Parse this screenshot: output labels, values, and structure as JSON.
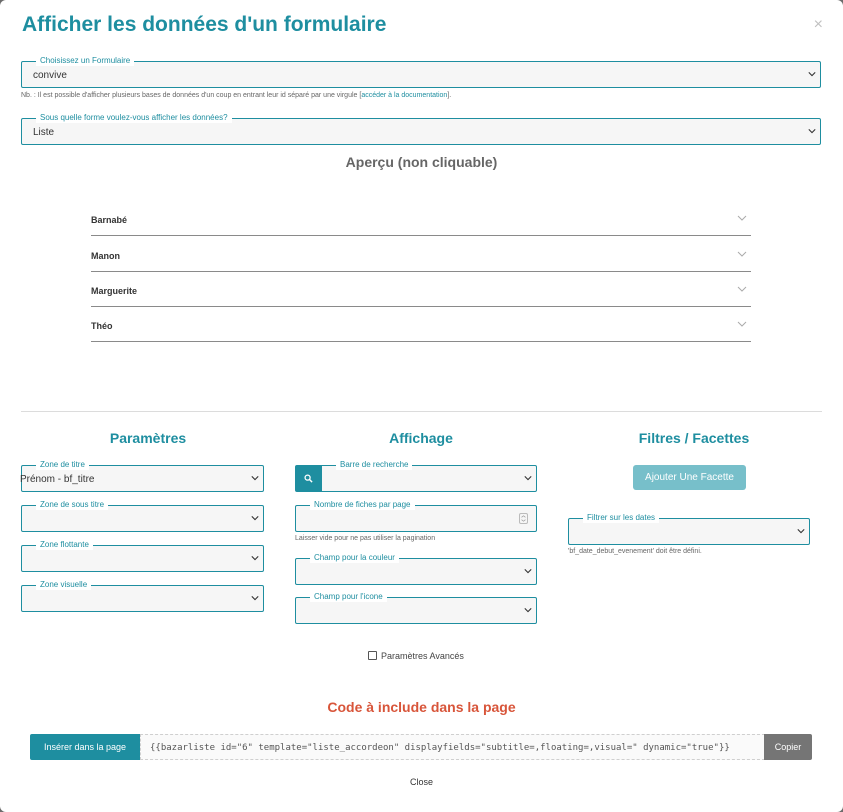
{
  "modal": {
    "title": "Afficher les données d'un formulaire",
    "close_symbol": "×"
  },
  "form_select": {
    "legend": "Choisissez un Formulaire",
    "value": "convive",
    "hint": "Nb. : Il est possible d'afficher plusieurs bases de données d'un coup en entrant leur id séparé par une virgule [",
    "hint_link": "accéder à la documentation",
    "hint_end": "]."
  },
  "display_select": {
    "legend": "Sous quelle forme voulez-vous afficher les données?",
    "value": "Liste"
  },
  "preview": {
    "title": "Aperçu (non cliquable)",
    "items": [
      {
        "label": "Barnabé"
      },
      {
        "label": "Manon"
      },
      {
        "label": "Marguerite"
      },
      {
        "label": "Théo"
      }
    ]
  },
  "parametres": {
    "title": "Paramètres",
    "zone_titre": {
      "legend": "Zone de titre",
      "value": "Prénom - bf_titre"
    },
    "zone_sous_titre": {
      "legend": "Zone de sous titre",
      "value": ""
    },
    "zone_flottante": {
      "legend": "Zone flottante",
      "value": ""
    },
    "zone_visuelle": {
      "legend": "Zone visuelle",
      "value": ""
    }
  },
  "affichage": {
    "title": "Affichage",
    "barre_recherche": {
      "legend": "Barre de recherche",
      "value": ""
    },
    "nombre_fiches": {
      "legend": "Nombre de fiches par page",
      "value": "",
      "hint": "Laisser vide pour ne pas utiliser la pagination"
    },
    "champ_couleur": {
      "legend": "Champ pour la couleur",
      "value": ""
    },
    "champ_icone": {
      "legend": "Champ pour l'icone",
      "value": ""
    }
  },
  "filtres": {
    "title": "Filtres / Facettes",
    "add_facet_label": "Ajouter Une Facette",
    "filtrer_dates": {
      "legend": "Filtrer sur les dates",
      "value": "",
      "hint": "'bf_date_debut_evenement' doit être défini."
    }
  },
  "advanced": {
    "label": "Paramètres Avancés",
    "checked": false
  },
  "code": {
    "title": "Code à include dans la page",
    "insert_label": "Insérer dans la page",
    "snippet": "{{bazarliste id=\"6\" template=\"liste_accordeon\" displayfields=\"subtitle=,floating=,visual=\" dynamic=\"true\"}}",
    "copy_label": "Copier"
  },
  "footer": {
    "close_label": "Close"
  },
  "colors": {
    "accent": "#1e8ea0",
    "code_title": "#d8553a",
    "facet_button": "#77bfca",
    "copy_button": "#757575"
  }
}
